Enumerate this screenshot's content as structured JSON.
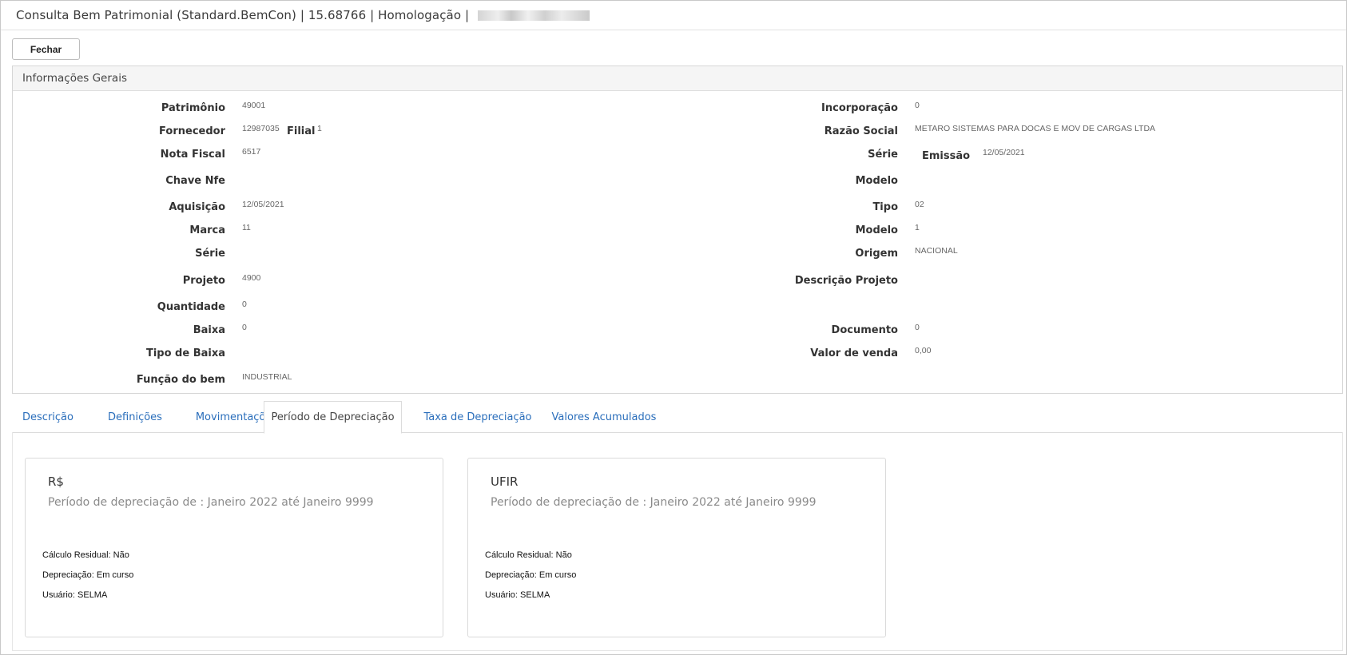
{
  "window": {
    "title": "Consulta Bem Patrimonial (Standard.BemCon) | 15.68766 | Homologação | "
  },
  "toolbar": {
    "close_label": "Fechar"
  },
  "general_info": {
    "heading": "Informações Gerais",
    "left": [
      {
        "label": "Patrimônio",
        "value": "49001"
      },
      {
        "label": "Fornecedor",
        "value": "12987035"
      },
      {
        "label": "Nota Fiscal",
        "value": "6517"
      },
      {
        "label": "Chave Nfe",
        "value": ""
      },
      {
        "label": "Aquisição",
        "value": "12/05/2021"
      },
      {
        "label": "Marca",
        "value": "11"
      },
      {
        "label": "Série",
        "value": ""
      },
      {
        "label": "Projeto",
        "value": "4900"
      },
      {
        "label": "Quantidade",
        "value": "0"
      },
      {
        "label": "Baixa",
        "value": "0"
      },
      {
        "label": "Tipo de Baixa",
        "value": ""
      },
      {
        "label": "Função do bem",
        "value": "INDUSTRIAL"
      }
    ],
    "filial": {
      "label": "Filial",
      "value": "1"
    },
    "right": [
      {
        "label": "Incorporação",
        "value": "0"
      },
      {
        "label": "Razão Social",
        "value": "METARO SISTEMAS PARA DOCAS E MOV DE CARGAS LTDA"
      },
      {
        "label": "Série",
        "value": ""
      },
      {
        "label": "Modelo",
        "value": ""
      },
      {
        "label": "Tipo",
        "value": "02"
      },
      {
        "label": "Modelo",
        "value": "1"
      },
      {
        "label": "Origem",
        "value": "NACIONAL"
      },
      {
        "label": "Descrição Projeto",
        "value": ""
      },
      {
        "label": "Documento",
        "value": "0"
      },
      {
        "label": "Valor de venda",
        "value": "0,00"
      }
    ],
    "emissao": {
      "label": "Emissão",
      "value": "12/05/2021"
    }
  },
  "tabs": [
    {
      "label": "Descrição"
    },
    {
      "label": "Definições"
    },
    {
      "label": "Movimentações"
    },
    {
      "label": "Período de Depreciação"
    },
    {
      "label": "Taxa de Depreciação"
    },
    {
      "label": "Valores Acumulados"
    }
  ],
  "cards": [
    {
      "title": "R$",
      "period": "Período de depreciação de : Janeiro 2022 até Janeiro 9999",
      "residual": "Cálculo Residual: Não",
      "depreciation": "Depreciação: Em curso",
      "user": "Usuário: SELMA"
    },
    {
      "title": "UFIR",
      "period": "Período de depreciação de : Janeiro 2022 até Janeiro 9999",
      "residual": "Cálculo Residual: Não",
      "depreciation": "Depreciação: Em curso",
      "user": "Usuário: SELMA"
    }
  ]
}
